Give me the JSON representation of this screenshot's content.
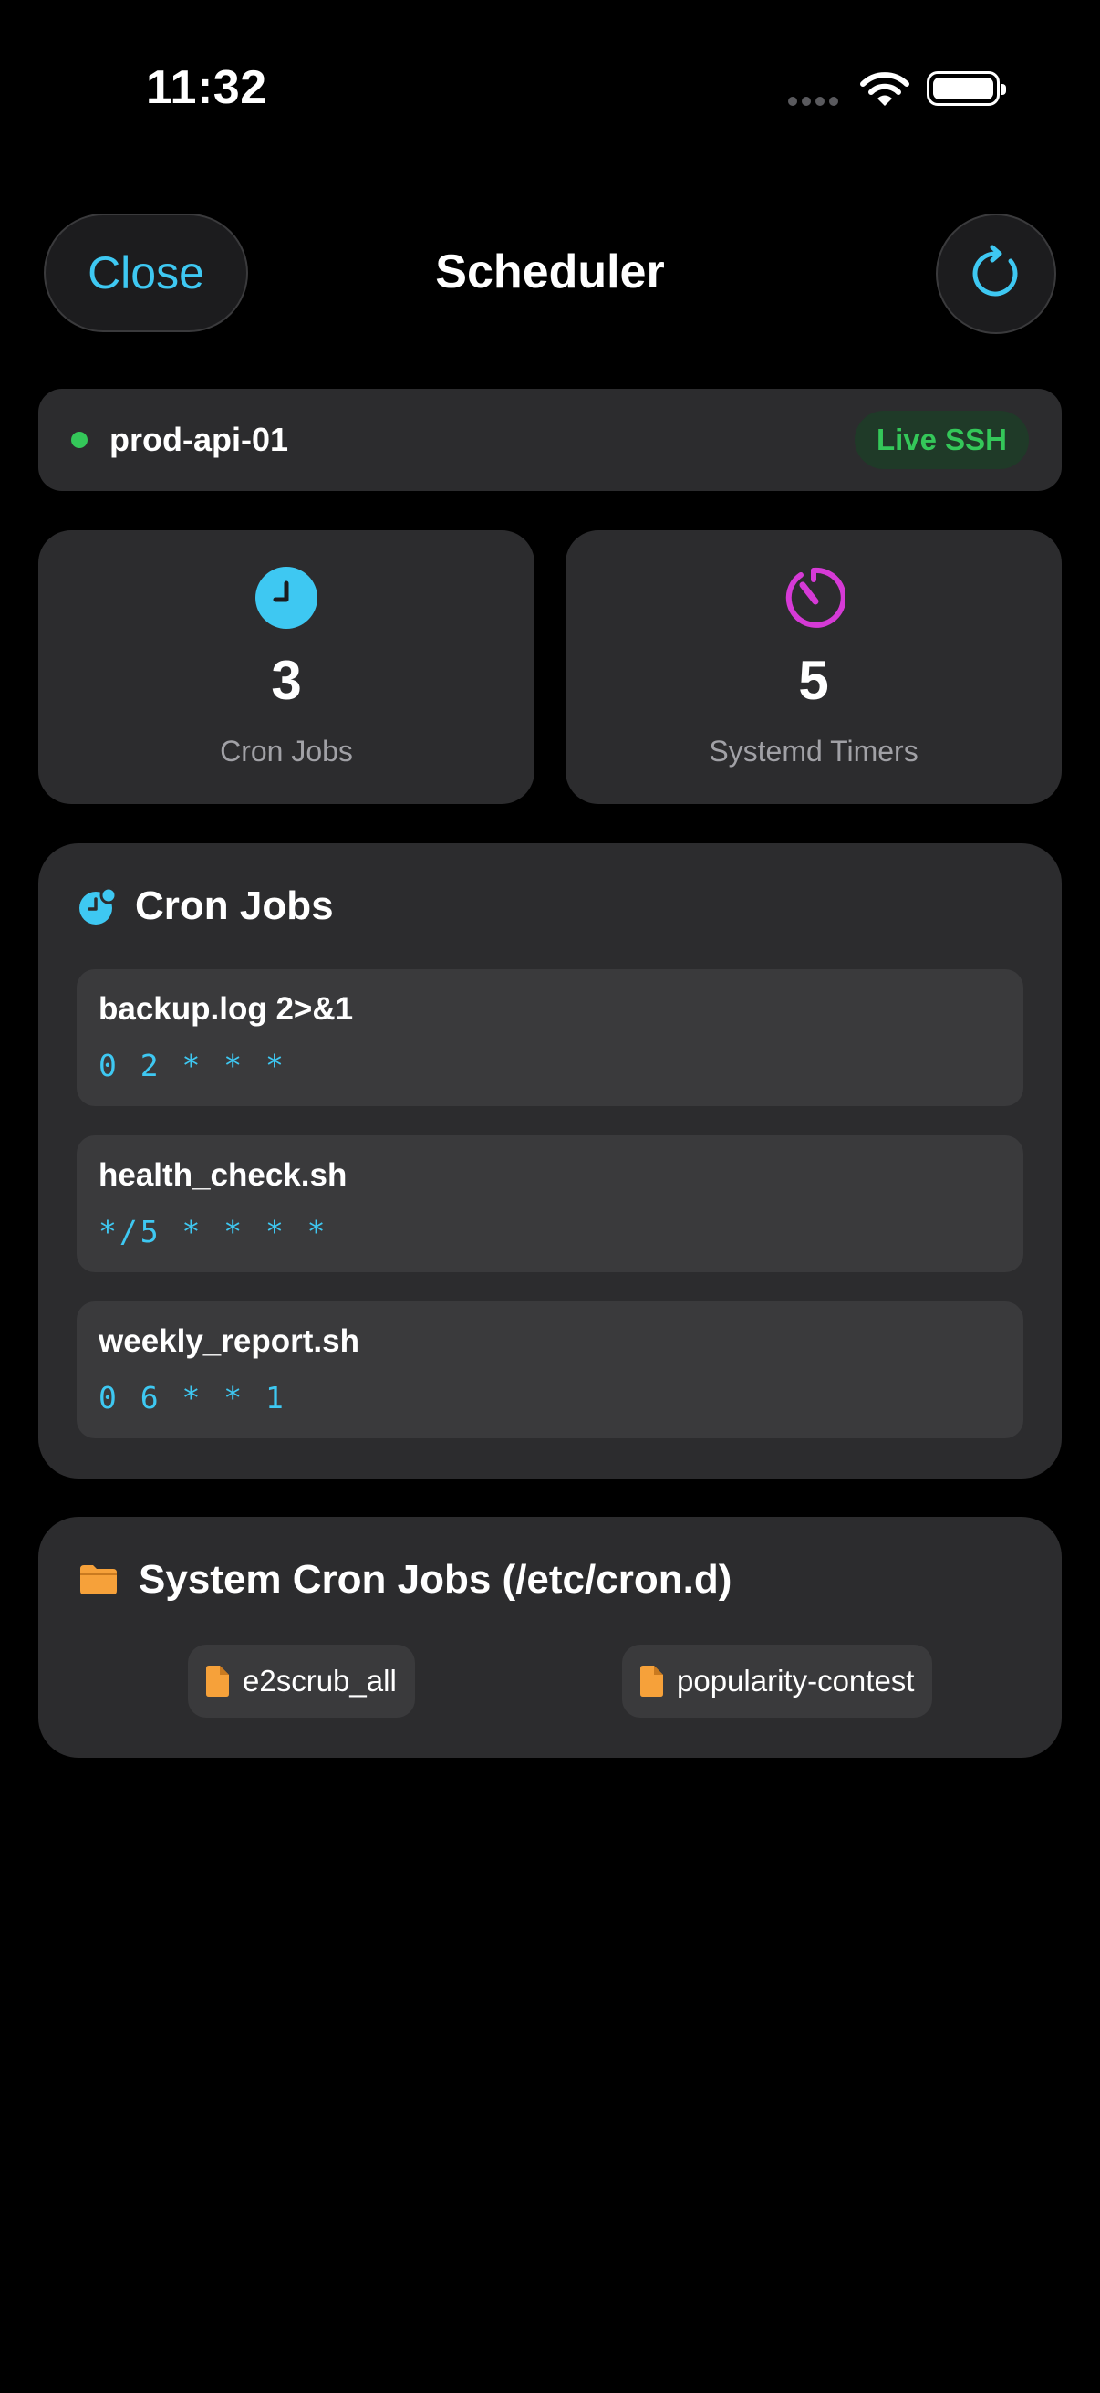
{
  "status_bar": {
    "time": "11:32"
  },
  "header": {
    "close_label": "Close",
    "title": "Scheduler"
  },
  "server": {
    "name": "prod-api-01",
    "connection_badge": "Live SSH",
    "status_color": "#34c759"
  },
  "stats": [
    {
      "value": "3",
      "label": "Cron Jobs",
      "icon": "clock-icon",
      "color": "#3ec8f2"
    },
    {
      "value": "5",
      "label": "Systemd Timers",
      "icon": "timer-icon",
      "color": "#d63ad6"
    }
  ],
  "cron_section": {
    "title": "Cron Jobs",
    "jobs": [
      {
        "name": "backup.log 2>&1",
        "schedule": "0 2 * * *"
      },
      {
        "name": "health_check.sh",
        "schedule": "*/5 * * * *"
      },
      {
        "name": "weekly_report.sh",
        "schedule": "0 6 * * 1"
      }
    ]
  },
  "system_section": {
    "title": "System Cron Jobs (/etc/cron.d)",
    "files": [
      "e2scrub_all",
      "popularity-contest"
    ]
  },
  "colors": {
    "accent": "#3ec8f2",
    "folder": "#f6a13a",
    "card": "#2c2c2e",
    "row": "#3a3a3c"
  }
}
